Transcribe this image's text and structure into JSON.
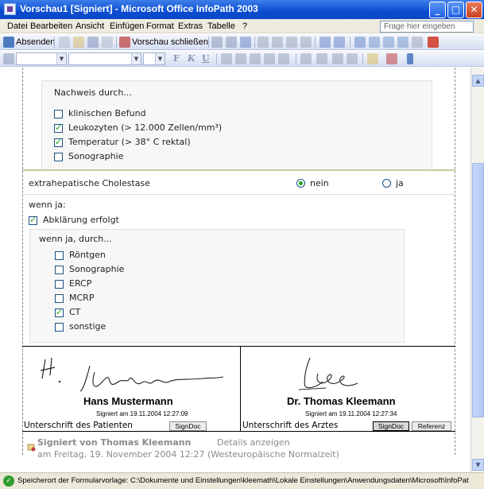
{
  "window": {
    "title": "Vorschau1 [Signiert] - Microsoft Office InfoPath 2003",
    "minimize": "_",
    "restore": "□",
    "close": "✕"
  },
  "menu": [
    "Datei",
    "Bearbeiten",
    "Ansicht",
    "Einfügen",
    "Format",
    "Extras",
    "Tabelle",
    "?"
  ],
  "help_search": {
    "placeholder": "Frage hier eingeben"
  },
  "toolbar": {
    "send_label": "Absenden",
    "close_preview_label": "Vorschau schließen",
    "font_style_bold": "F",
    "font_style_italic": "K",
    "font_style_underline": "U"
  },
  "form": {
    "nachweis": {
      "heading": "Nachweis durch...",
      "options": [
        {
          "label": "klinischen Befund",
          "checked": false
        },
        {
          "label": "Leukozyten (> 12.000 Zellen/mm³)",
          "checked": true
        },
        {
          "label": "Temperatur (> 38° C rektal)",
          "checked": true
        },
        {
          "label": "Sonographie",
          "checked": false
        }
      ]
    },
    "cholestase": {
      "label": "extrahepatische Cholestase",
      "options": [
        {
          "label": "nein",
          "selected": true
        },
        {
          "label": "ja",
          "selected": false
        }
      ]
    },
    "wenn_ja": {
      "heading": "wenn ja:",
      "abklaerung": {
        "label": "Abklärung erfolgt",
        "checked": true
      },
      "sub_heading": "wenn ja, durch...",
      "methods": [
        {
          "label": "Röntgen",
          "checked": false
        },
        {
          "label": "Sonographie",
          "checked": false
        },
        {
          "label": "ERCP",
          "checked": false
        },
        {
          "label": "MCRP",
          "checked": false
        },
        {
          "label": "CT",
          "checked": true
        },
        {
          "label": "sonstige",
          "checked": false
        }
      ]
    },
    "signatures": {
      "patient": {
        "name": "Hans Mustermann",
        "signed": "Signiert am 19.11.2004 12:27:09",
        "label": "Unterschrift des Patienten",
        "button": "SignDoc"
      },
      "doctor": {
        "name": "Dr. Thomas Kleemann",
        "signed": "Signiert am 19.11.2004 12:27:34",
        "label": "Unterschrift des Arztes",
        "button": "SignDoc",
        "reference_button": "Referenz"
      }
    },
    "signature_summary": {
      "signed_by": "Signiert von Thomas Kleemann",
      "details_link": "Details anzeigen",
      "date": "am Freitag, 19. November 2004 12:27 (Westeuropäische Normalzeit)"
    }
  },
  "status": {
    "text": "Speicherort der Formularvorlage: C:\\Dokumente und Einstellungen\\kleemath\\Lokale Einstellungen\\Anwendungsdaten\\Microsoft\\InfoPat"
  }
}
